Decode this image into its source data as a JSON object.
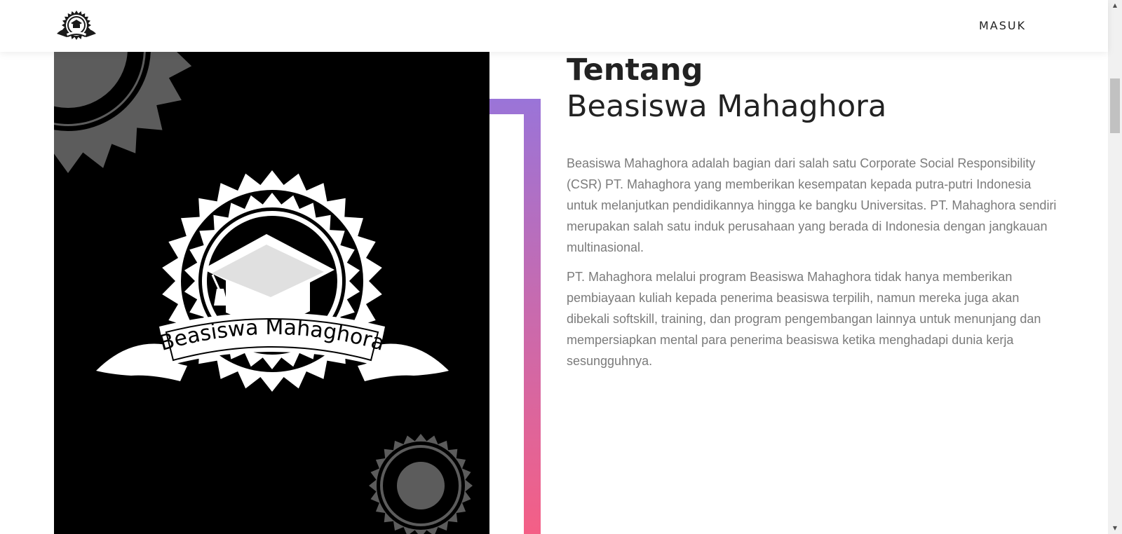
{
  "navbar": {
    "logo_icon": "scholarship-seal-logo-icon",
    "login_label": "MASUK"
  },
  "hero": {
    "logo_text": "Beasiswa Mahaghora",
    "colors": {
      "background": "#000000",
      "emblem": "#ffffff",
      "decor_gear": "#5c5c5c"
    }
  },
  "accent": {
    "gradient_top": "#9a74d8",
    "gradient_bottom": "#f45f86"
  },
  "about": {
    "title_strong": "Tentang",
    "title_light": "Beasiswa Mahaghora",
    "paragraph1": "Beasiswa Mahaghora adalah bagian dari salah satu Corporate Social Responsibility (CSR) PT. Mahaghora yang memberikan kesempatan kepada putra-putri Indonesia untuk melanjutkan pendidikannya hingga ke bangku Universitas. PT. Mahaghora sendiri merupakan salah satu induk perusahaan yang berada di Indonesia dengan jangkauan multinasional.",
    "paragraph2": "PT. Mahaghora melalui program Beasiswa Mahaghora tidak hanya memberikan pembiayaan kuliah kepada penerima beasiswa terpilih, namun mereka juga akan dibekali softskill, training, dan program pengembangan lainnya untuk menunjang dan mempersiapkan mental para penerima beasiswa ketika menghadapi dunia kerja sesungguhnya."
  },
  "scrollbar": {
    "up_icon": "scroll-up-arrow-icon",
    "down_icon": "scroll-down-arrow-icon",
    "up_glyph": "▲",
    "down_glyph": "▼"
  }
}
